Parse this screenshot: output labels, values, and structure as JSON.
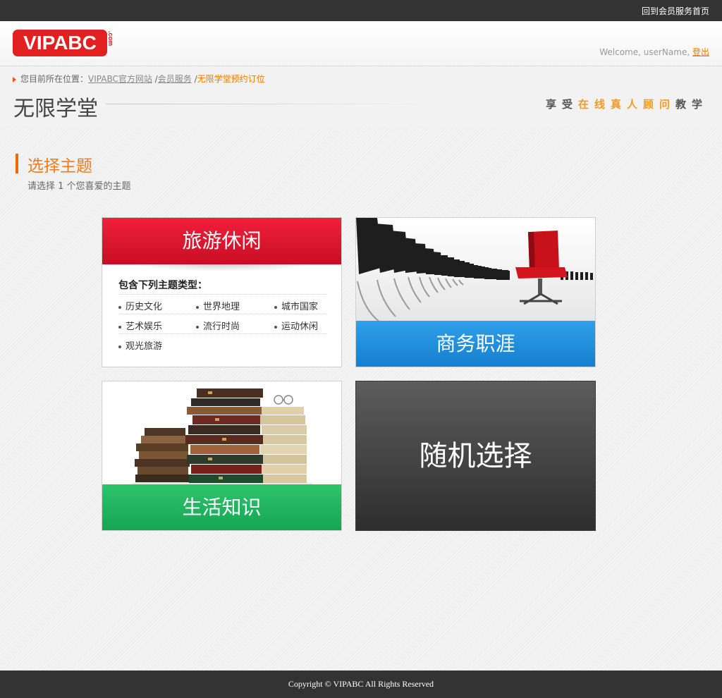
{
  "topbar": {
    "back_link": "回到会员服务首页"
  },
  "logo": {
    "text": "VIPABC",
    "suffix": ".com"
  },
  "header": {
    "welcome": "Welcome, userName,",
    "logout": "登出"
  },
  "breadcrumb": {
    "prefix": "您目前所在位置：",
    "items": [
      "VIPABC官方网站",
      "会员服务"
    ],
    "current": "无限学堂预约订位",
    "separator": "/"
  },
  "page": {
    "title": "无限学堂",
    "slogan": {
      "part1": "享受",
      "highlight": "在线真人顾问",
      "part2": "教学"
    }
  },
  "section": {
    "title": "选择主题",
    "subtitle": "请选择 1 个您喜爱的主题"
  },
  "cards": {
    "travel": {
      "label": "旅游休闲",
      "subtitle": "包含下列主题类型：",
      "tags": [
        "历史文化",
        "世界地理",
        "城市国家",
        "艺术娱乐",
        "流行时尚",
        "运动休闲",
        "观光旅游"
      ]
    },
    "business": {
      "label": "商务职涯"
    },
    "life": {
      "label": "生活知识"
    },
    "random": {
      "label": "随机选择"
    }
  },
  "footer": {
    "copyright": "Copyright © VIPABC All Rights Reserved"
  },
  "colors": {
    "accent_orange": "#ee7800",
    "travel_red": "#e0162f",
    "business_blue": "#1f8fdc",
    "life_green": "#22b45e",
    "random_gray": "#4a4a4a",
    "logo_red": "#e1201f"
  }
}
